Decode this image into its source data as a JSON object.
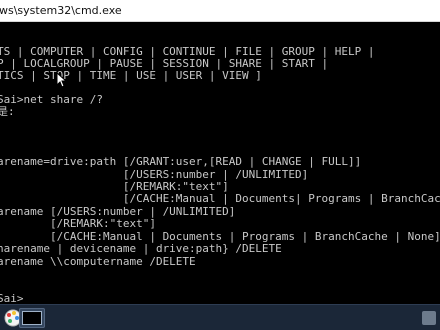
{
  "window": {
    "title": "ws\\system32\\cmd.exe"
  },
  "console": {
    "lines": [
      "TS | COMPUTER | CONFIG | CONTINUE | FILE | GROUP | HELP |",
      "P | LOCALGROUP | PAUSE | SESSION | SHARE | START |",
      "TICS | STOP | TIME | USE | USER | VIEW ]",
      "",
      "Sai>net share /?",
      "是:",
      "",
      "",
      "",
      "",
      "arename=drive:path [/GRANT:user,[READ | CHANGE | FULL]]",
      "                   [/USERS:number | /UNLIMITED]",
      "                   [/REMARK:\"text\"]",
      "                   [/CACHE:Manual | Documents| Programs | BranchCache | None]",
      "arename [/USERS:number | /UNLIMITED]",
      "        [/REMARK:\"text\"]",
      "        [/CACHE:Manual | Documents | Programs | BranchCache | None]",
      "harename | devicename | drive:path} /DELETE",
      "arename \\\\computername /DELETE",
      "",
      "",
      "",
      "Sai>"
    ]
  },
  "taskbar": {
    "items": [
      {
        "icon": "paint-icon",
        "active": false
      },
      {
        "icon": "cmd-icon",
        "active": true
      }
    ],
    "tray_icon": "tray-icon"
  },
  "colors": {
    "console_bg": "#000000",
    "console_text": "#c8c8c8",
    "titlebar_bg": "#ffffff",
    "taskbar_bg": "#1b2738"
  }
}
